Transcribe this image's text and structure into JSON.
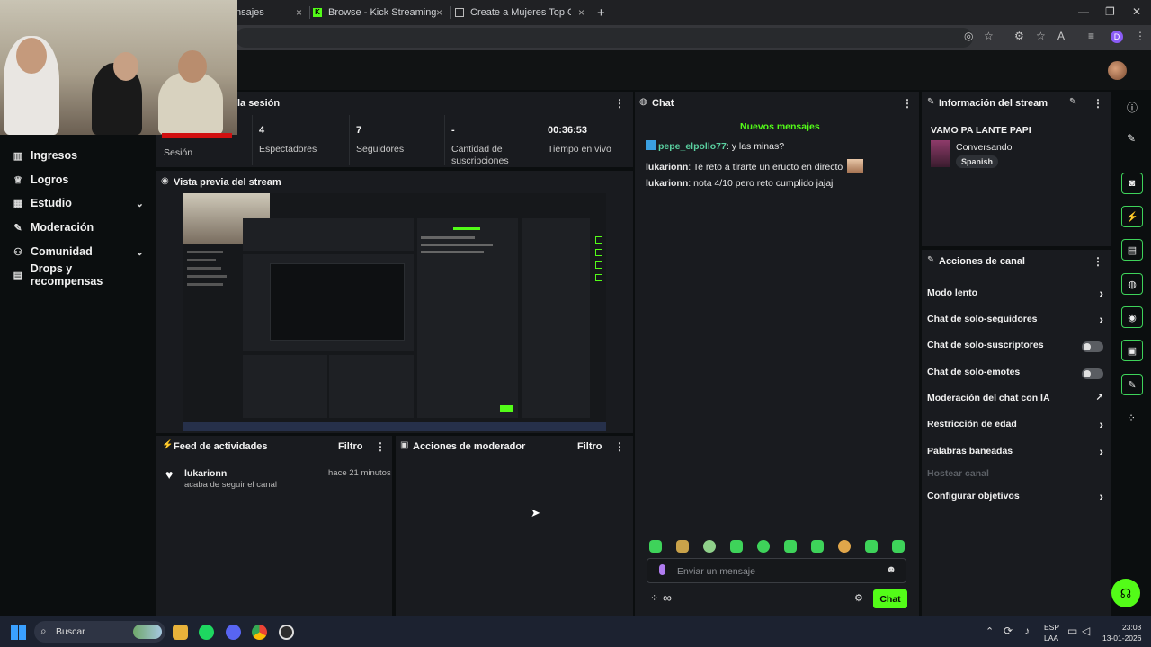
{
  "browser": {
    "tabs": [
      {
        "title": "nsajes"
      },
      {
        "title": "Browse - Kick Streaming"
      },
      {
        "title": "Create a Mujeres Top Oficial Ti"
      }
    ],
    "new_tab": "+",
    "close": "×",
    "window_controls": [
      "—",
      "❐",
      "✕"
    ],
    "profile_initial": "D"
  },
  "sidebar": {
    "items": [
      {
        "label": "Ingresos",
        "icon": "chart-icon"
      },
      {
        "label": "Logros",
        "icon": "trophy-icon"
      },
      {
        "label": "Estudio",
        "icon": "grid-icon",
        "expandable": true
      },
      {
        "label": "Moderación",
        "icon": "wrench-icon"
      },
      {
        "label": "Comunidad",
        "icon": "users-icon",
        "expandable": true
      },
      {
        "label": "Drops y recompensas",
        "icon": "gift-icon"
      }
    ]
  },
  "session": {
    "title": "la sesión",
    "stats": [
      {
        "value": "",
        "label": "Sesión"
      },
      {
        "value": "4",
        "label": "Espectadores"
      },
      {
        "value": "7",
        "label": "Seguidores"
      },
      {
        "value": "-",
        "label": "Cantidad de suscripciones"
      },
      {
        "value": "00:36:53",
        "label": "Tiempo en vivo"
      }
    ]
  },
  "preview": {
    "title": "Vista previa del stream"
  },
  "activity": {
    "title": "Feed de actividades",
    "filter": "Filtro",
    "items": [
      {
        "user": "lukarionn",
        "text": "acaba de seguir el canal",
        "time": "hace 21 minutos"
      }
    ]
  },
  "mod_actions": {
    "title": "Acciones de moderador",
    "filter": "Filtro"
  },
  "chat": {
    "title": "Chat",
    "new_messages": "Nuevos mensajes",
    "messages": [
      {
        "user": "pepe_elpollo77",
        "text": ": y las minas?",
        "color": "#5ad0a0"
      },
      {
        "user": "lukarionn",
        "text": ": Te reto a tirarte un eructo en directo",
        "color": "#f0f0f0"
      },
      {
        "user": "lukarionn",
        "text": ": nota 4/10 pero reto cumplido jajaj",
        "color": "#f0f0f0"
      }
    ],
    "input_placeholder": "Enviar un mensaje",
    "send_label": "Chat",
    "emote_count": 10
  },
  "stream_info": {
    "title": "Información del stream",
    "stream_title": "VAMO PA LANTE PAPI",
    "category": "Conversando",
    "language": "Spanish"
  },
  "channel_actions": {
    "title": "Acciones de canal",
    "items": [
      {
        "label": "Modo lento",
        "control": "chevron"
      },
      {
        "label": "Chat de solo-seguidores",
        "control": "chevron"
      },
      {
        "label": "Chat de solo-suscriptores",
        "control": "toggle"
      },
      {
        "label": "Chat de solo-emotes",
        "control": "toggle"
      },
      {
        "label": "Moderación del chat con IA",
        "control": "external"
      },
      {
        "label": "Restricción de edad",
        "control": "chevron"
      },
      {
        "label": "Palabras baneadas",
        "control": "chevron"
      },
      {
        "label": "Hostear canal",
        "control": "none",
        "disabled": true
      },
      {
        "label": "Configurar objetivos",
        "control": "chevron"
      }
    ]
  },
  "taskbar": {
    "search": "Buscar",
    "lang_top": "ESP",
    "lang_bottom": "LAA",
    "time": "23:03",
    "date": "13-01-2026"
  },
  "colors": {
    "accent": "#53fc18",
    "panel": "#191b1f",
    "bg": "#0b0e0f"
  }
}
